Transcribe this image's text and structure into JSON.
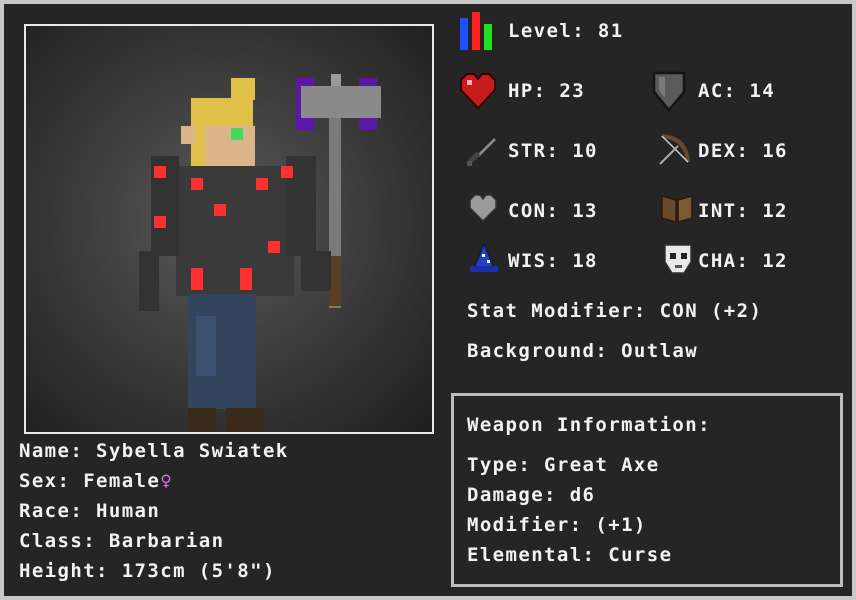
{
  "character": {
    "name_label": "Name: Sybella Swiatek",
    "sex_label": "Sex: Female",
    "sex_symbol": "♀",
    "race_label": "Race: Human",
    "class_label": "Class: Barbarian",
    "height_label": "Height: 173cm (5'8\")"
  },
  "stats": {
    "level": "Level: 81",
    "hp": "HP: 23",
    "ac": "AC: 14",
    "str": "STR: 10",
    "dex": "DEX: 16",
    "con": "CON: 13",
    "int": "INT: 12",
    "wis": "WIS: 18",
    "cha": "CHA: 12",
    "stat_modifier": "Stat Modifier: CON (+2)",
    "background": "Background: Outlaw"
  },
  "weapon": {
    "heading": "Weapon Information:",
    "type": "Type: Great Axe",
    "damage": "Damage: d6",
    "modifier": "Modifier: (+1)",
    "elemental": "Elemental: Curse"
  },
  "icons": {
    "level": "level-bars-icon",
    "hp": "heart-icon",
    "ac": "shield-icon",
    "str": "sword-icon",
    "dex": "bow-icon",
    "con": "gray-heart-icon",
    "int": "book-icon",
    "wis": "wizard-hat-icon",
    "cha": "mask-icon"
  },
  "colors": {
    "background": "#252525",
    "frame": "#c8c8c8",
    "accent_red": "#ff3030",
    "sex_pink": "#e26ee8",
    "axe_purple": "#5a18a8"
  }
}
